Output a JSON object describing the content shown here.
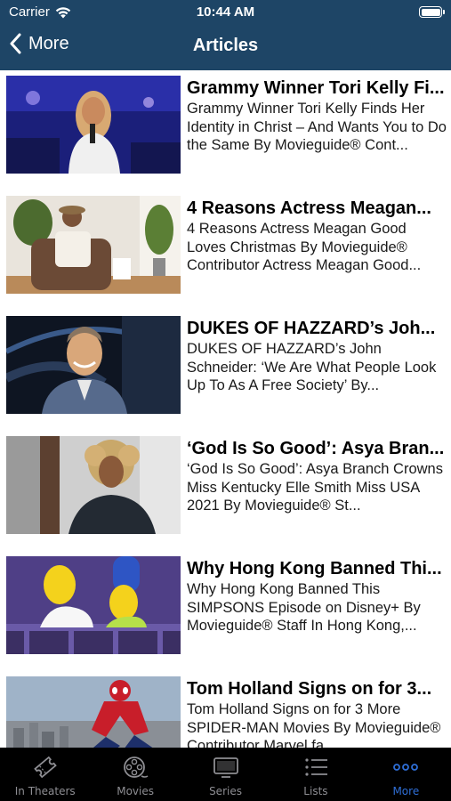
{
  "status_bar": {
    "carrier": "Carrier",
    "time": "10:44 AM",
    "battery_level": 1.0
  },
  "nav": {
    "back_label": "More",
    "title": "Articles"
  },
  "colors": {
    "nav_background": "#1e4566",
    "tab_bar_background": "#000000",
    "tab_inactive": "#8e8e93",
    "tab_active": "#2f6fd8"
  },
  "articles": [
    {
      "title": "Grammy Winner Tori Kelly Fi...",
      "description": "Grammy Winner Tori Kelly Finds Her Identity in Christ – And Wants You to Do the Same By Movieguide® Cont...",
      "thumbnail": "singer-on-stage-photo"
    },
    {
      "title": "4 Reasons Actress Meagan...",
      "description": "4 Reasons Actress Meagan Good Loves Christmas By Movieguide® Contributor Actress Meagan Good...",
      "thumbnail": "actress-in-armchair-photo"
    },
    {
      "title": "DUKES OF HAZZARD’s Joh...",
      "description": "DUKES OF HAZZARD’s John Schneider: ‘We Are What People Look Up To As A Free Society’ By...",
      "thumbnail": "smiling-man-portrait-photo"
    },
    {
      "title": "‘God Is So Good’: Asya Bran...",
      "description": "‘God Is So Good’: Asya Branch Crowns Miss Kentucky Elle Smith Miss USA 2021 By Movieguide® St...",
      "thumbnail": "woman-curly-hair-portrait-photo"
    },
    {
      "title": "Why Hong Kong Banned Thi...",
      "description": "Why Hong Kong Banned This SIMPSONS Episode on Disney+ By Movieguide® Staff In Hong Kong,...",
      "thumbnail": "cartoon-family-still"
    },
    {
      "title": "Tom Holland Signs on for 3...",
      "description": "Tom Holland Signs on for 3 More SPIDER-MAN Movies By Movieguide® Contributor Marvel fa...",
      "thumbnail": "superhero-city-still"
    }
  ],
  "tabs": [
    {
      "label": "In Theaters",
      "icon": "ticket-icon",
      "active": false
    },
    {
      "label": "Movies",
      "icon": "film-reel-icon",
      "active": false
    },
    {
      "label": "Series",
      "icon": "tv-icon",
      "active": false
    },
    {
      "label": "Lists",
      "icon": "list-icon",
      "active": false
    },
    {
      "label": "More",
      "icon": "more-dots-icon",
      "active": true
    }
  ]
}
